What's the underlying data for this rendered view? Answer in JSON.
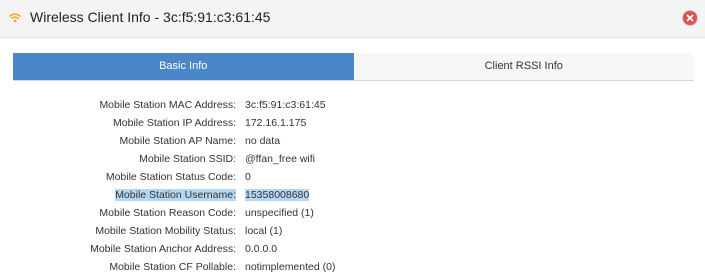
{
  "window": {
    "title": "Wireless Client Info - 3c:f5:91:c3:61:45",
    "title_icon": "wifi-icon",
    "close_icon": "close-icon"
  },
  "tabs": [
    {
      "label": "Basic Info",
      "active": true
    },
    {
      "label": "Client RSSI Info",
      "active": false
    }
  ],
  "basic_info": {
    "rows": [
      {
        "label": "Mobile Station MAC Address:",
        "value": "3c:f5:91:c3:61:45"
      },
      {
        "label": "Mobile Station IP Address:",
        "value": "172.16.1.175"
      },
      {
        "label": "Mobile Station AP Name:",
        "value": "no data"
      },
      {
        "label": "Mobile Station SSID:",
        "value": "@ffan_free wifi"
      },
      {
        "label": "Mobile Station Status Code:",
        "value": "0"
      },
      {
        "label": "Mobile Station Username:",
        "value": "15358008680",
        "selected": true
      },
      {
        "label": "Mobile Station Reason Code:",
        "value": "unspecified (1)"
      },
      {
        "label": "Mobile Station Mobility Status:",
        "value": "local (1)"
      },
      {
        "label": "Mobile Station Anchor Address:",
        "value": "0.0.0.0"
      },
      {
        "label": "Mobile Station CF Pollable:",
        "value": "notimplemented (0)"
      }
    ]
  },
  "colors": {
    "tab_active": "#4a86c8",
    "selection_highlight": "#b4d6f5",
    "close_button": "#d9534f",
    "wifi_icon": "#f5a623"
  }
}
